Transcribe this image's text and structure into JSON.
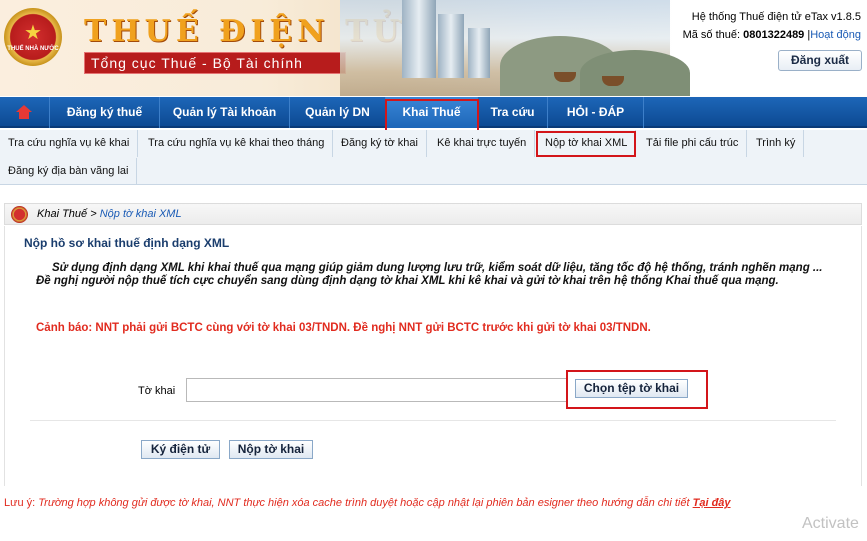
{
  "header": {
    "brand_title": "THUẾ ĐIỆN TỬ",
    "brand_subtitle": "Tổng cục Thuế - Bộ Tài chính",
    "emblem_text": "THUẾ NHÀ NƯỚC",
    "system_label": "Hệ thống Thuế điện tử eTax v1.8.5",
    "tax_id_label": "Mã số thuế:",
    "tax_id_value": "0801322489",
    "separator": "|",
    "activity_link": "Hoạt động",
    "logout_label": "Đăng xuất"
  },
  "main_nav": {
    "items": [
      {
        "label": "Đăng ký thuế"
      },
      {
        "label": "Quản lý Tài khoản"
      },
      {
        "label": "Quản lý DN"
      },
      {
        "label": "Khai Thuế"
      },
      {
        "label": "Tra cứu"
      },
      {
        "label": "HỎI - ĐÁP"
      }
    ],
    "active": "Khai Thuế"
  },
  "sub_nav": {
    "items": [
      {
        "label": "Tra cứu nghĩa vụ kê khai"
      },
      {
        "label": "Tra cứu nghĩa vụ kê khai theo tháng"
      },
      {
        "label": "Đăng ký tờ khai"
      },
      {
        "label": "Kê khai trực tuyến"
      },
      {
        "label": "Nộp tờ khai XML"
      },
      {
        "label": "Tải file phi cấu trúc"
      },
      {
        "label": "Trình ký"
      },
      {
        "label": "Đăng ký địa bàn vãng lai"
      }
    ],
    "active": "Nộp tờ khai XML"
  },
  "breadcrumb": {
    "parent": "Khai Thuế",
    "separator": ">",
    "current": "Nộp tờ khai XML"
  },
  "content": {
    "title": "Nộp hồ sơ khai thuế định dạng XML",
    "intro": "Sử dụng định dạng XML khi khai thuế qua mạng giúp giảm dung lượng lưu trữ, kiểm soát dữ liệu, tăng tốc độ hệ thống, tránh nghẽn mạng ... Đề nghị người nộp thuế tích cực chuyển sang dùng định dạng tờ khai XML khi kê khai và gửi tờ khai trên hệ thống Khai thuế qua mạng.",
    "warning": "Cảnh báo: NNT phải gửi BCTC cùng với tờ khai 03/TNDN. Đề nghị NNT gửi BCTC trước khi gửi tờ khai 03/TNDN.",
    "form": {
      "label": "Tờ khai",
      "file_value": "",
      "choose_button": "Chọn tệp tờ khai"
    },
    "sign_button": "Ký điện tử",
    "submit_button": "Nộp tờ khai"
  },
  "note": {
    "prefix": "Lưu ý:",
    "text": "Trường hợp không gửi được tờ khai, NNT thực hiện xóa cache trình duyệt hoặc cập nhật lại phiên bản esigner theo hướng dẫn chi tiết",
    "link": "Tại đây"
  },
  "watermark": "Activate",
  "colors": {
    "nav_blue": "#1d66b8",
    "highlight_red": "#d3151a",
    "warning_red": "#e12b1f",
    "brand_orange": "#f0a11e",
    "brand_red": "#b71c1c"
  },
  "icons": [
    "emblem-icon",
    "home-icon",
    "breadcrumb-emblem-icon"
  ]
}
